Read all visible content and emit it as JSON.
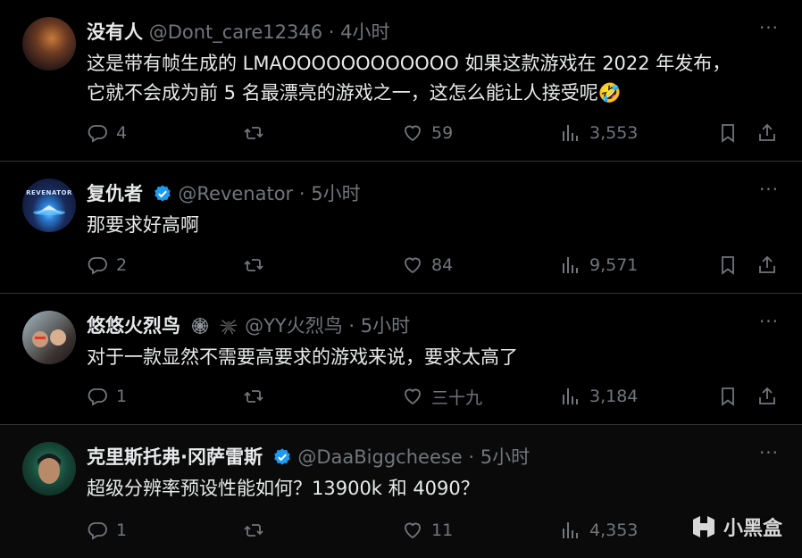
{
  "tweets": [
    {
      "name": "没有人",
      "handle": "@Dont_care12346",
      "dot": "·",
      "time": "4小时",
      "verified": false,
      "body": "这是带有帧生成的 LMAOOOOOOOOOOOO 如果这款游戏在 2022 年发布，它就不会成为前 5 名最漂亮的游戏之一，这怎么能让人接受呢🤣",
      "replies": "4",
      "retweets": "",
      "likes": "59",
      "views": "3,553",
      "more": "···"
    },
    {
      "name": "复仇者",
      "handle": "@Revenator",
      "dot": "·",
      "time": "5小时",
      "verified": true,
      "avatar_text": "REVENATOR",
      "body": "那要求好高啊",
      "replies": "2",
      "retweets": "",
      "likes": "84",
      "views": "9,571",
      "more": "···"
    },
    {
      "name": "悠悠火烈鸟",
      "handle": "@YY火烈鸟",
      "dot": "·",
      "time": "5小时",
      "verified": false,
      "name_icons": [
        "spider-web-icon",
        "spider-icon"
      ],
      "body": "对于一款显然不需要高要求的游戏来说，要求太高了",
      "replies": "1",
      "retweets": "",
      "likes": "三十九",
      "views": "3,184",
      "more": "···"
    },
    {
      "name": "克里斯托弗·冈萨雷斯",
      "handle": "@DaaBiggcheese",
      "dot": "·",
      "time": "5小时",
      "verified": true,
      "body": "超级分辨率预设性能如何？13900k 和 4090？",
      "replies": "1",
      "retweets": "",
      "likes": "11",
      "views": "4,353",
      "more": "···"
    }
  ],
  "watermark": {
    "text": "小黑盒",
    "icon": "heybox-logo-icon"
  },
  "colors": {
    "background": "#000000",
    "text": "#e7e9ea",
    "muted": "#71767b",
    "border": "#2f3336",
    "verified": "#1d9bf0"
  }
}
